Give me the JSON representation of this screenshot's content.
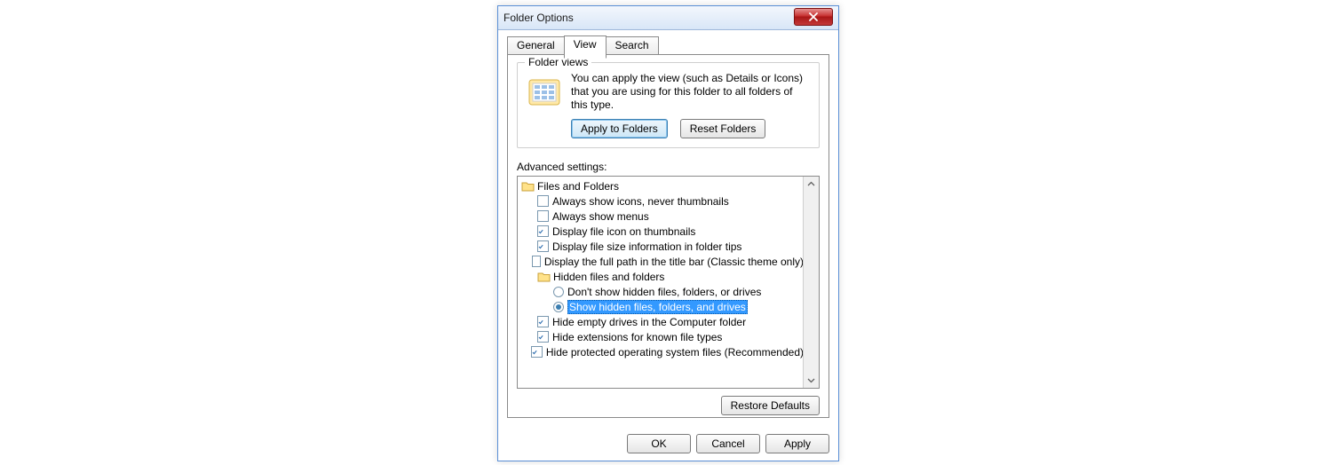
{
  "window": {
    "title": "Folder Options"
  },
  "tabs": {
    "general": "General",
    "view": "View",
    "search": "Search"
  },
  "folderViews": {
    "groupTitle": "Folder views",
    "description": "You can apply the view (such as Details or Icons) that you are using for this folder to all folders of this type.",
    "applyBtn": "Apply to Folders",
    "resetBtn": "Reset Folders"
  },
  "advanced": {
    "label": "Advanced settings:",
    "rootLabel": "Files and Folders",
    "items": {
      "alwaysIcons": {
        "label": "Always show icons, never thumbnails",
        "checked": false
      },
      "alwaysMenus": {
        "label": "Always show menus",
        "checked": false
      },
      "fileIconThumb": {
        "label": "Display file icon on thumbnails",
        "checked": true
      },
      "fileSizeTips": {
        "label": "Display file size information in folder tips",
        "checked": true
      },
      "fullPathTitle": {
        "label": "Display the full path in the title bar (Classic theme only)",
        "checked": false
      },
      "hiddenGroup": {
        "label": "Hidden files and folders"
      },
      "radioDontShow": {
        "label": "Don't show hidden files, folders, or drives",
        "selected": false
      },
      "radioShowHidden": {
        "label": "Show hidden files, folders, and drives",
        "selected": true
      },
      "hideEmptyDrives": {
        "label": "Hide empty drives in the Computer folder",
        "checked": true
      },
      "hideExtensions": {
        "label": "Hide extensions for known file types",
        "checked": true
      },
      "hideProtectedOS": {
        "label": "Hide protected operating system files (Recommended)",
        "checked": true
      }
    },
    "restoreBtn": "Restore Defaults"
  },
  "buttons": {
    "ok": "OK",
    "cancel": "Cancel",
    "apply": "Apply"
  }
}
